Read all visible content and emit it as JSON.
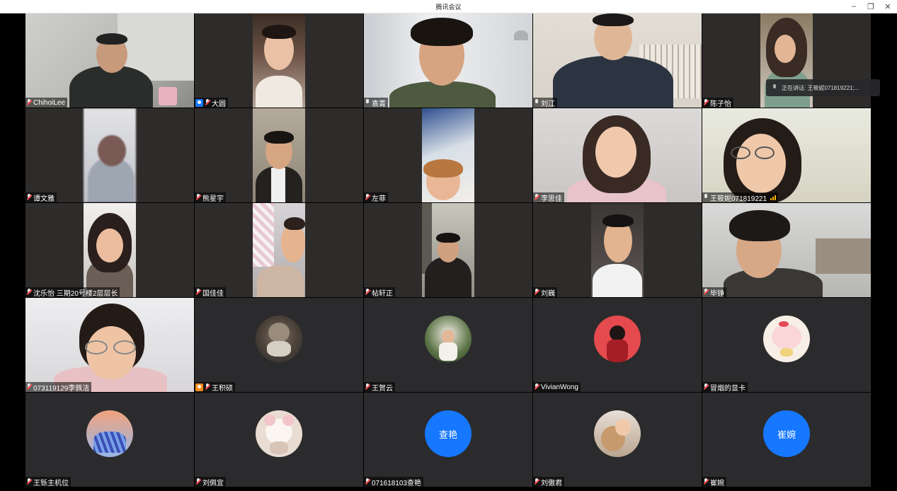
{
  "window": {
    "title": "腾讯会议",
    "minimize_icon": "minimize-icon",
    "restore_icon": "restore-icon",
    "close_icon": "close-icon"
  },
  "speaking_tip": {
    "text": "正在讲话: 王筱妮071819221;..."
  },
  "participants": [
    {
      "name": "ChihoiLee"
    },
    {
      "name": "大圆"
    },
    {
      "name": "袁菁"
    },
    {
      "name": "刘江"
    },
    {
      "name": "陈子怡"
    },
    {
      "name": "谭文雅"
    },
    {
      "name": "熊星宇"
    },
    {
      "name": "左菲"
    },
    {
      "name": "李思佳"
    },
    {
      "name": "王筱妮071819221"
    },
    {
      "name": "沈乐怡 三期20号楼2层层长"
    },
    {
      "name": "国佳佳"
    },
    {
      "name": "帖轩正"
    },
    {
      "name": "刘巍"
    },
    {
      "name": "毕铮"
    },
    {
      "name": "073119129李佩洁"
    },
    {
      "name": "王积硕"
    },
    {
      "name": "王贺云"
    },
    {
      "name": "VivianWong"
    },
    {
      "name": "冒烟的显卡"
    },
    {
      "name": "王铄主机位"
    },
    {
      "name": "刘佩宜"
    },
    {
      "name": "071618103查艳",
      "avatar_text": "查艳"
    },
    {
      "name": "刘傲君"
    },
    {
      "name": "崔婉",
      "avatar_text": "崔婉"
    }
  ],
  "colors": {
    "tile_bg": "#2e2c2b",
    "avatar_blue": "#1677ff",
    "speaking_border": "#3fb26a",
    "muted_red": "#ff4d4f"
  }
}
